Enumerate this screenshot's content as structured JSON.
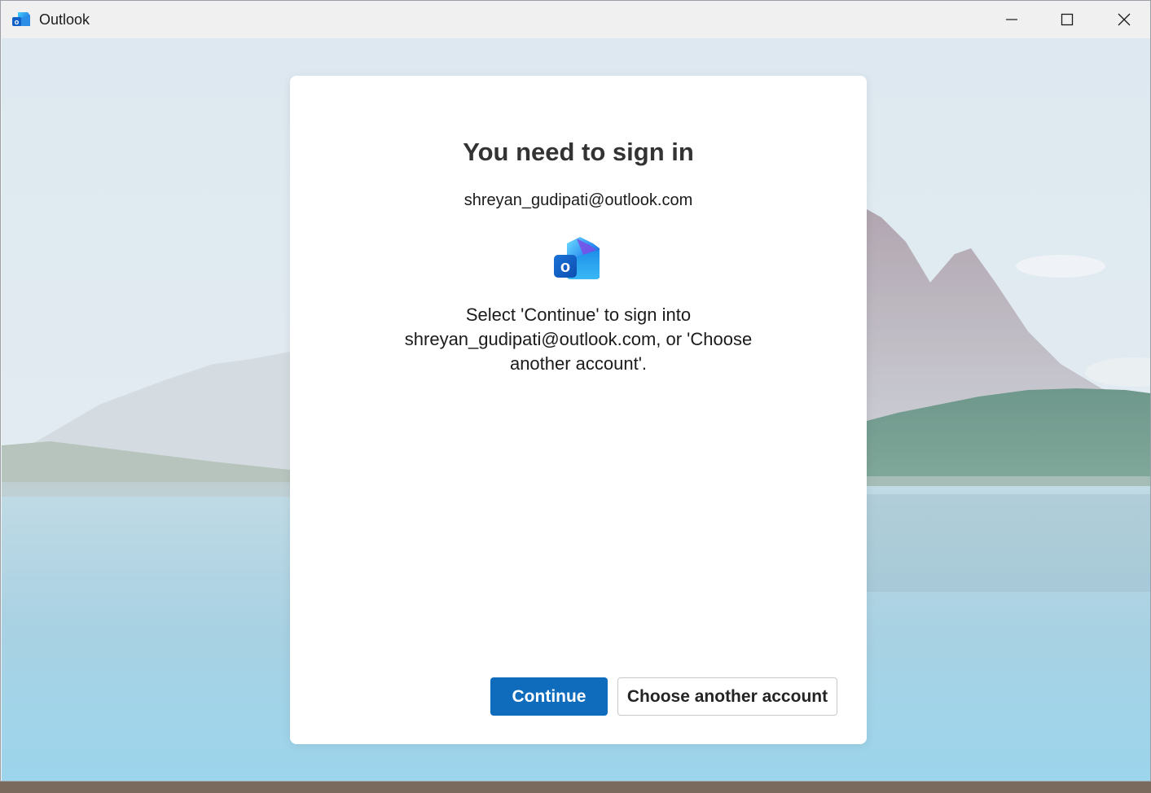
{
  "window": {
    "title": "Outlook",
    "controls": {
      "minimize": "minimize-icon",
      "maximize": "maximize-icon",
      "close": "close-icon"
    }
  },
  "dialog": {
    "title": "You need to sign in",
    "email": "shreyan_gudipati@outlook.com",
    "message": "Select 'Continue' to sign into shreyan_gudipati@outlook.com, or 'Choose another account'.",
    "continue_label": "Continue",
    "choose_label": "Choose another account"
  },
  "colors": {
    "primary_button": "#0f6cbd",
    "dialog_bg": "#ffffff",
    "titlebar_bg": "#f0f0f0"
  }
}
